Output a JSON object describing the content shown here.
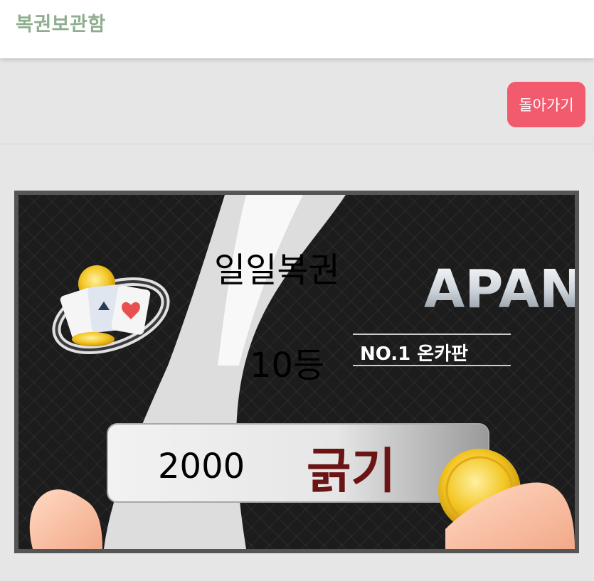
{
  "header": {
    "title": "복권보관함"
  },
  "actions": {
    "back_label": "돌아가기"
  },
  "ticket": {
    "banner_brand": "APAN",
    "banner_tagline": "NO.1 온카판",
    "banner_button_text": "긁기",
    "lottery_name": "일일복권",
    "rank": "10등",
    "prize": "2000"
  },
  "colors": {
    "title": "#8fae8f",
    "back_button": "#f25b6e"
  }
}
